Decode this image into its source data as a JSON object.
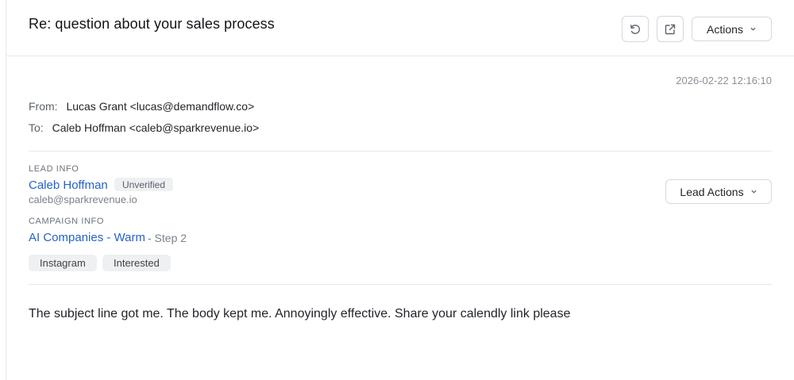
{
  "email": {
    "subject": "Re: question about your sales process",
    "timestamp": "2026-02-22 12:16:10",
    "from_label": "From:",
    "from_value": "Lucas Grant <lucas@demandflow.co>",
    "to_label": "To:",
    "to_value": "Caleb Hoffman <caleb@sparkrevenue.io>",
    "body": "The subject line got me. The body kept me. Annoyingly effective. Share your calendly link please"
  },
  "toolbar": {
    "actions_label": "Actions",
    "icons": [
      "undo-icon",
      "open-external-icon",
      "chevron-down-icon"
    ]
  },
  "lead": {
    "section_label": "LEAD INFO",
    "name": "Caleb Hoffman",
    "status_badge": "Unverified",
    "email": "caleb@sparkrevenue.io",
    "actions_label": "Lead Actions"
  },
  "campaign": {
    "section_label": "CAMPAIGN INFO",
    "name": "AI Companies - Warm",
    "step": "- Step 2"
  },
  "tags": [
    "Instagram",
    "Interested"
  ],
  "colors": {
    "link": "#2463c7",
    "badge_bg": "#eef0f2",
    "border": "#d5d8dc"
  }
}
